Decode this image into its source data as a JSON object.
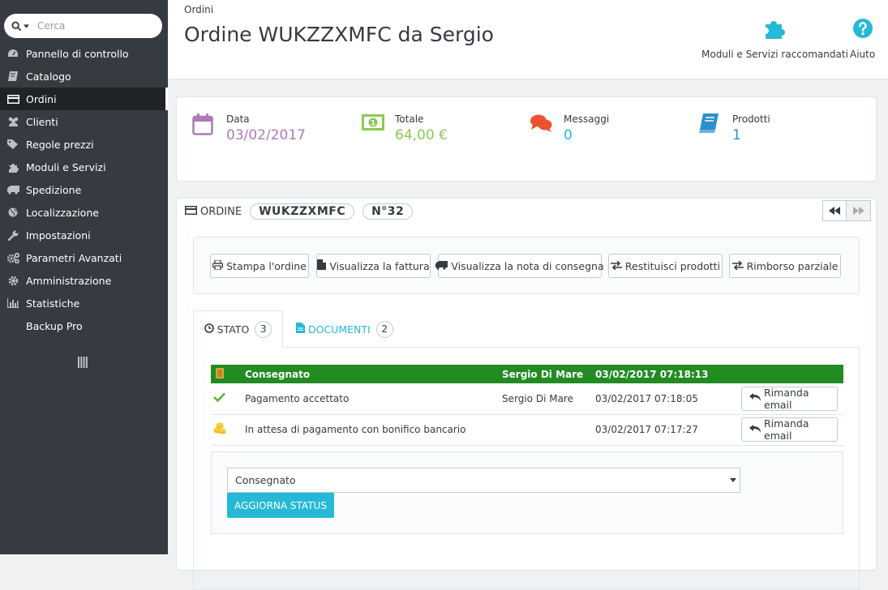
{
  "search": {
    "placeholder": "Cerca"
  },
  "sidebar": {
    "items": [
      {
        "label": "Pannello di controllo",
        "icon": "dashboard-icon"
      },
      {
        "label": "Catalogo",
        "icon": "book-icon"
      },
      {
        "label": "Ordini",
        "icon": "credit-card-icon"
      },
      {
        "label": "Clienti",
        "icon": "users-icon"
      },
      {
        "label": "Regole prezzi",
        "icon": "tags-icon"
      },
      {
        "label": "Moduli e Servizi",
        "icon": "puzzle-icon"
      },
      {
        "label": "Spedizione",
        "icon": "truck-icon"
      },
      {
        "label": "Localizzazione",
        "icon": "globe-icon"
      },
      {
        "label": "Impostazioni",
        "icon": "wrench-icon"
      },
      {
        "label": "Parametri Avanzati",
        "icon": "cogs-icon"
      },
      {
        "label": "Amministrazione",
        "icon": "gear-icon"
      },
      {
        "label": "Statistiche",
        "icon": "bar-chart-icon"
      },
      {
        "label": "Backup Pro",
        "icon": ""
      }
    ],
    "active_item": "Ordini"
  },
  "header": {
    "breadcrumb": "Ordini",
    "title": "Ordine WUKZZXMFC da Sergio",
    "toolbar": {
      "modules_label": "Moduli e Servizi raccomandati",
      "help_label": "Aiuto"
    }
  },
  "kpis": [
    {
      "label": "Data",
      "value": "03/02/2017",
      "color": "#ab7ab7",
      "icon": "calendar-icon"
    },
    {
      "label": "Totale",
      "value": "64,00 €",
      "color": "#8bc954",
      "icon": "money-icon"
    },
    {
      "label": "Messaggi",
      "value": "0",
      "color": "#25b9d7",
      "icon": "comments-icon"
    },
    {
      "label": "Prodotti",
      "value": "1",
      "color": "#2d8ecc",
      "icon": "book-icon"
    }
  ],
  "order": {
    "heading": "ORDINE",
    "reference": "WUKZZXMFC",
    "number": "N°32",
    "actions": {
      "print": "Stampa l'ordine",
      "invoice": "Visualizza la fattura",
      "delivery": "Visualizza la nota di consegna",
      "return": "Restituisci prodotti",
      "refund": "Rimborso parziale"
    }
  },
  "tabs": {
    "status": {
      "label": "STATO",
      "count": "3"
    },
    "documents": {
      "label": "DOCUMENTI",
      "count": "2"
    }
  },
  "history": [
    {
      "status": "Consegnato",
      "employee": "Sergio Di Mare",
      "date": "03/02/2017 07:18:13",
      "icon": "truck-icon",
      "current": true
    },
    {
      "status": "Pagamento accettato",
      "employee": "Sergio Di Mare",
      "date": "03/02/2017 07:18:05",
      "icon": "check-icon",
      "resend": "Rimanda email"
    },
    {
      "status": "In attesa di pagamento con bonifico bancario",
      "employee": "",
      "date": "03/02/2017 07:17:27",
      "icon": "coins-icon",
      "resend": "Rimanda email"
    }
  ],
  "status_form": {
    "selected": "Consegnato",
    "update_label": "AGGIORNA STATUS"
  },
  "colors": {
    "sidebar": "#363a41",
    "accent": "#25b9d7",
    "current_status": "#228b22"
  }
}
